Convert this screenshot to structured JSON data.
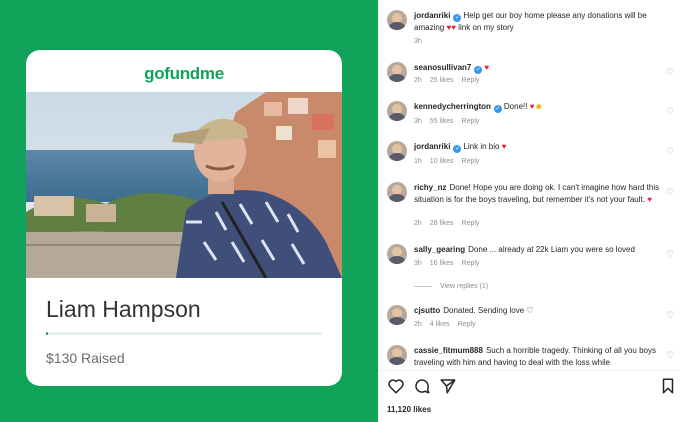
{
  "fundraiser": {
    "logo": "gofundme",
    "name": "Liam Hampson",
    "raised": "$130 Raised",
    "progress_fraction": 0.005,
    "brand_color": "#12a35a"
  },
  "post": {
    "caption_user": "jordanriki",
    "caption_text": "Help get our boy home please any donations will be amazing",
    "caption_suffix": "link on my story",
    "caption_time": "3h"
  },
  "comments": [
    {
      "user": "seanosullivan7",
      "text": "",
      "time": "2h",
      "likes": "25 likes",
      "reply": "Reply"
    },
    {
      "user": "kennedycherrington",
      "text": "Done!!",
      "time": "3h",
      "likes": "55 likes",
      "reply": "Reply"
    },
    {
      "user": "jordanriki",
      "text": "Link in bio",
      "time": "1h",
      "likes": "10 likes",
      "reply": "Reply"
    },
    {
      "user": "richy_nz",
      "text": "Done! Hope you are doing ok. I can't imagine how hard this situation is for the boys traveling, but remember it's not your fault.",
      "time": "2h",
      "likes": "28 likes",
      "reply": "Reply"
    },
    {
      "user": "sally_gearing",
      "text": "Done ... already at 22k Liam you were so loved",
      "time": "3h",
      "likes": "16 likes",
      "reply": "Reply"
    },
    {
      "user": "cjsutto",
      "text": "Donated. Sending love",
      "time": "2h",
      "likes": "4 likes",
      "reply": "Reply"
    },
    {
      "user": "cassie_fitmum888",
      "text": "Such a horrible tragedy. Thinking of all you boys traveling with him and having to deal with the loss while",
      "time": "",
      "likes": "",
      "reply": ""
    }
  ],
  "view_replies": "View replies (1)",
  "likes_count": "11,120 likes",
  "icons": {
    "like": "heart-outline-icon",
    "comment": "comment-bubble-icon",
    "share": "paper-plane-icon",
    "save": "bookmark-icon"
  }
}
